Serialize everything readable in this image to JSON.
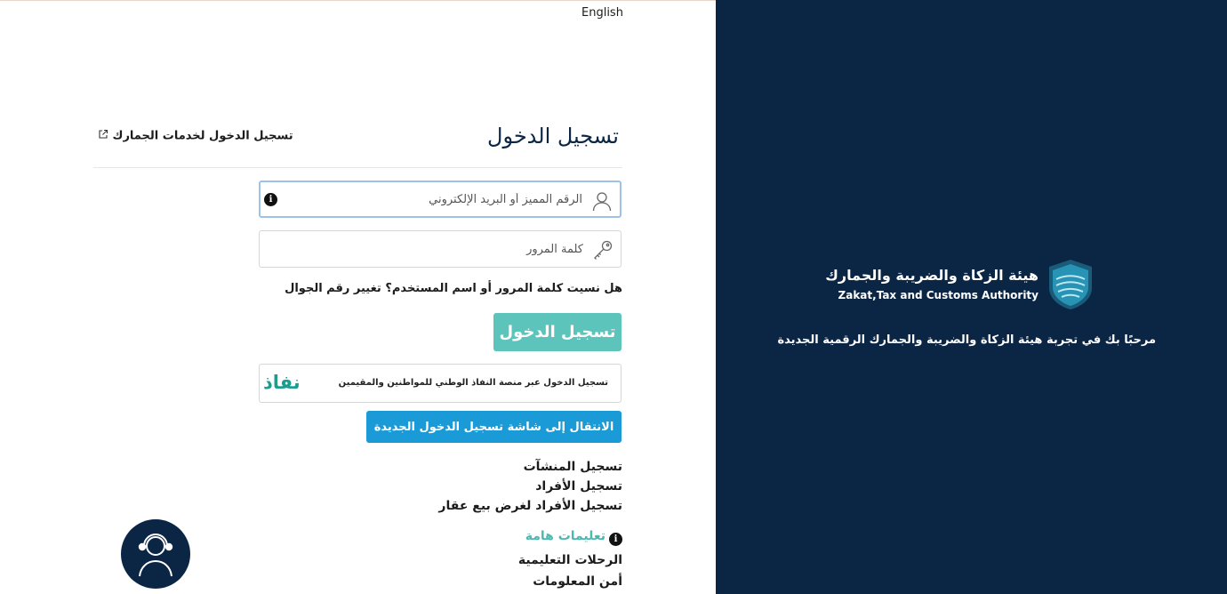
{
  "header": {
    "language_link": "English"
  },
  "login": {
    "title": "تسجيل الدخول",
    "customs_link": "تسجيل الدخول لخدمات الجمارك",
    "username_placeholder": "الرقم المميز أو البريد الإلكتروني",
    "password_placeholder": "كلمة المرور",
    "forgot_link": "هل نسيت كلمة المرور أو اسم المستخدم؟",
    "change_mobile_link": "تغيير رقم الجوال",
    "submit_label": "تسجيل الدخول",
    "nafath_text": "تسجيل الدخول عبر منصة النفاذ الوطني للمواطنين والمقيمين",
    "nafath_logo": "نفاذ",
    "new_login_label": "الانتقال إلى شاشة تسجيل الدخول الجديدة"
  },
  "registration": {
    "items": [
      {
        "label": "تسجيل المنشآت"
      },
      {
        "label": "تسجيل الأفراد"
      },
      {
        "label": "تسجيل الأفراد لغرض بيع عقار"
      }
    ]
  },
  "info": {
    "important_label": "تعليمات هامة",
    "items": [
      {
        "label": "الرحلات التعليمية"
      },
      {
        "label": "أمن المعلومات"
      }
    ]
  },
  "brand": {
    "name_ar": "هيئة الزكاة والضريبة والجمارك",
    "name_en": "Zakat,Tax and Customs Authority",
    "welcome": "مرحبًا بك في تجربة هيئة الزكاة والضريبة والجمارك الرقمية الجديدة"
  },
  "colors": {
    "navy": "#0b2545",
    "teal_button": "#5cc4bb",
    "blue_button": "#1a9bd8",
    "nafath_green": "#1b9d8f"
  },
  "icons": {
    "username": "user-icon",
    "password": "key-icon",
    "info": "info-icon",
    "external": "external-link-icon",
    "support": "support-agent-icon",
    "logo": "zatca-logo-icon"
  }
}
